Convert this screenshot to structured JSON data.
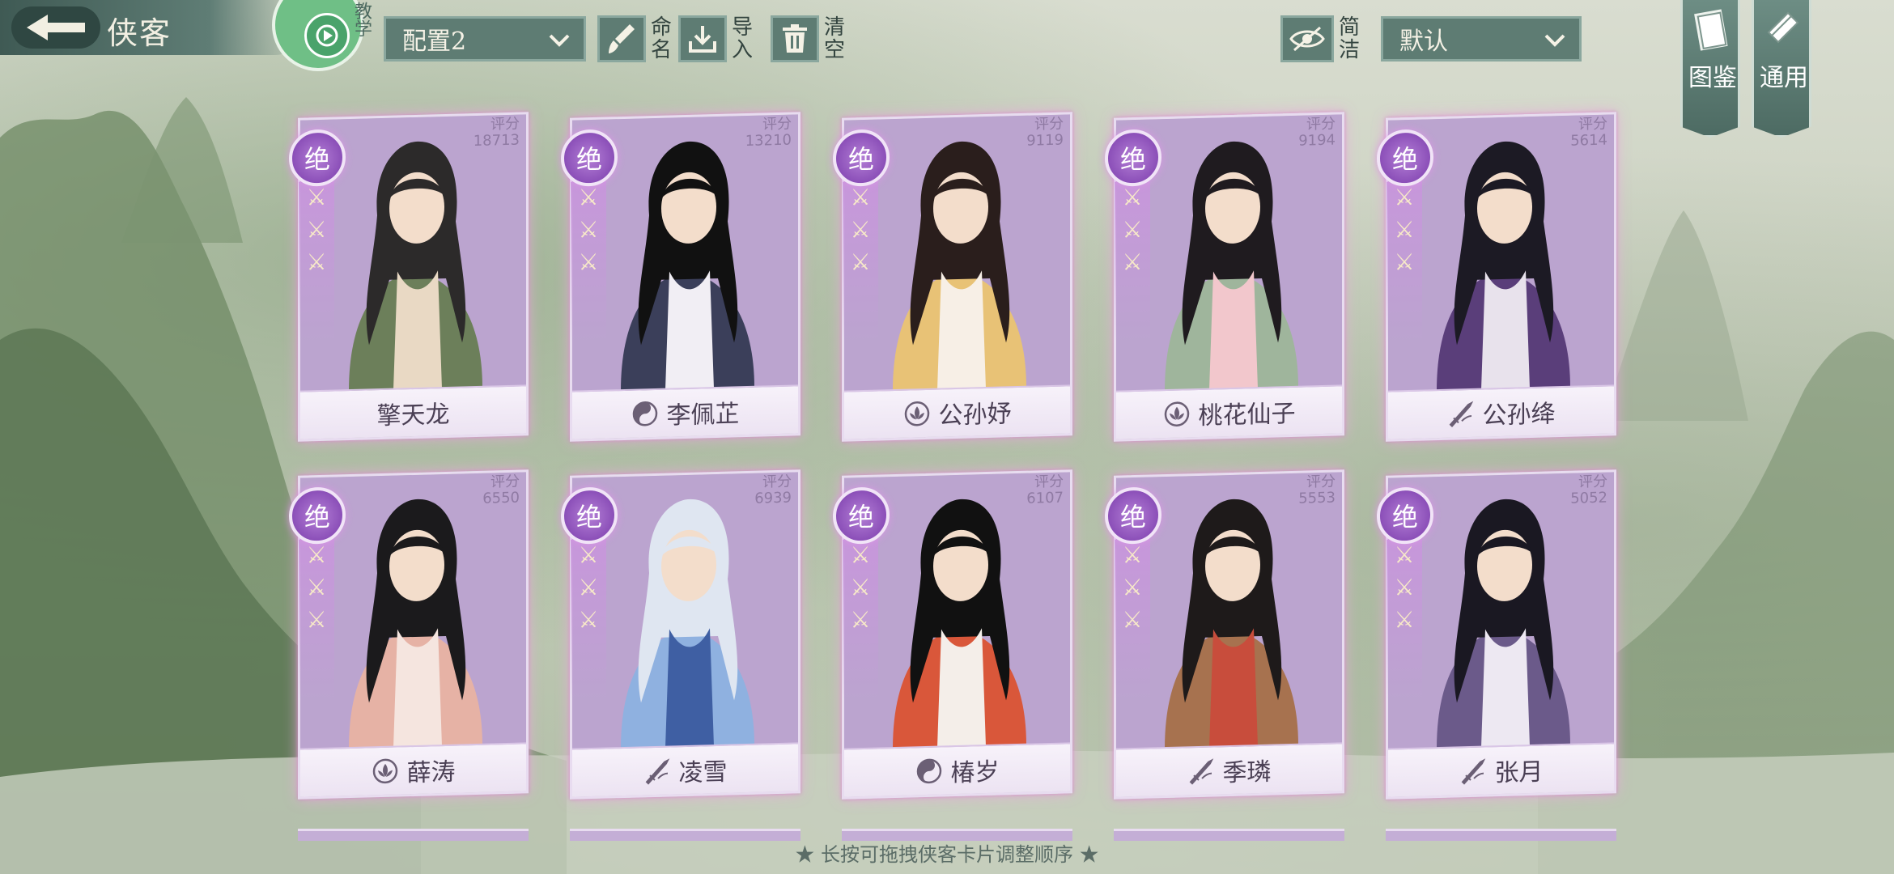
{
  "header": {
    "title": "侠客",
    "logo_text": "教学",
    "config_selected": "配置2",
    "buttons": {
      "rename": "命名",
      "import": "导入",
      "clear": "清空",
      "simple": "简洁"
    },
    "sort_selected": "默认"
  },
  "side_tabs": [
    {
      "label": "图鉴",
      "icon": "book-icon"
    },
    {
      "label": "通用",
      "icon": "scroll-icon"
    }
  ],
  "cards": [
    {
      "name": "擎天龙",
      "score_label": "评分",
      "score": "18713",
      "rank": "绝",
      "sect_icon": "",
      "palette": [
        "#6c7f5a",
        "#2c2a2a",
        "#e9d9c4"
      ]
    },
    {
      "name": "李佩芷",
      "score_label": "评分",
      "score": "13210",
      "rank": "绝",
      "sect_icon": "yinyang-icon",
      "palette": [
        "#3b3f5a",
        "#111111",
        "#f1eef4"
      ]
    },
    {
      "name": "公孙妤",
      "score_label": "评分",
      "score": "9119",
      "rank": "绝",
      "sect_icon": "lotus-icon",
      "palette": [
        "#e8c276",
        "#2a1e1c",
        "#f7efe6"
      ]
    },
    {
      "name": "桃花仙子",
      "score_label": "评分",
      "score": "9194",
      "rank": "绝",
      "sect_icon": "lotus-icon",
      "palette": [
        "#9fb59c",
        "#1f1b1f",
        "#f2c7cc"
      ]
    },
    {
      "name": "公孙绛",
      "score_label": "评分",
      "score": "5614",
      "rank": "绝",
      "sect_icon": "sword-icon",
      "palette": [
        "#5a3e7a",
        "#1c1a24",
        "#e8e2ec"
      ]
    },
    {
      "name": "薛涛",
      "score_label": "评分",
      "score": "6550",
      "rank": "绝",
      "sect_icon": "lotus-icon",
      "palette": [
        "#e6b2a5",
        "#1b1a1c",
        "#f5e5df"
      ]
    },
    {
      "name": "凌雪",
      "score_label": "评分",
      "score": "6939",
      "rank": "绝",
      "sect_icon": "sword-icon",
      "palette": [
        "#8fb1e0",
        "#dfe6f1",
        "#3f5fa3"
      ]
    },
    {
      "name": "椿岁",
      "score_label": "评分",
      "score": "6107",
      "rank": "绝",
      "sect_icon": "yinyang-icon",
      "palette": [
        "#d9573a",
        "#111111",
        "#f4eee9"
      ]
    },
    {
      "name": "季璘",
      "score_label": "评分",
      "score": "5553",
      "rank": "绝",
      "sect_icon": "sword-icon",
      "palette": [
        "#a7724f",
        "#1e1a1a",
        "#c84d3c"
      ]
    },
    {
      "name": "张月",
      "score_label": "评分",
      "score": "5052",
      "rank": "绝",
      "sect_icon": "sword-icon",
      "palette": [
        "#6b5a8a",
        "#1a1822",
        "#ede8f2"
      ]
    }
  ],
  "hint": "★ 长按可拖拽侠客卡片调整顺序 ★"
}
